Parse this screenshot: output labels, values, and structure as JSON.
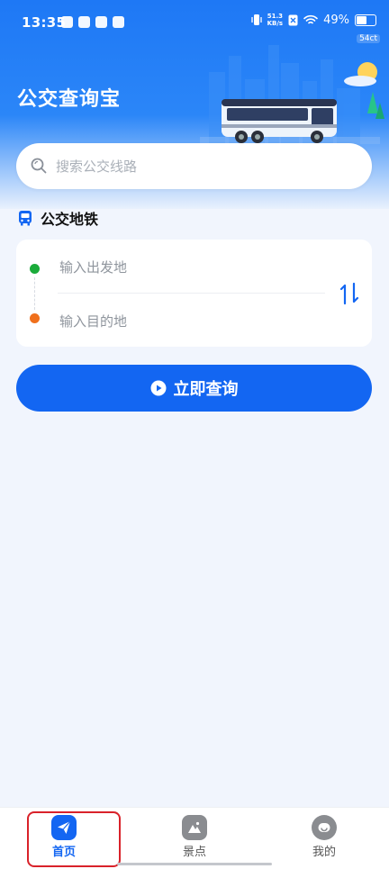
{
  "status_bar": {
    "time": "13:35",
    "net_speed": "51.3",
    "net_unit": "KB/s",
    "battery": "49%",
    "extra_tag": "54ct"
  },
  "header": {
    "title": "公交查询宝"
  },
  "search": {
    "placeholder": "搜索公交线路"
  },
  "section": {
    "title": "公交地铁"
  },
  "route": {
    "start_placeholder": "输入出发地",
    "end_placeholder": "输入目的地"
  },
  "query_button": {
    "label": "立即查询"
  },
  "nav": {
    "home": "首页",
    "spots": "景点",
    "me": "我的"
  },
  "colors": {
    "primary": "#1366f2",
    "start_dot": "#1aab3a",
    "end_dot": "#f0701c",
    "highlight": "#d9222a"
  }
}
